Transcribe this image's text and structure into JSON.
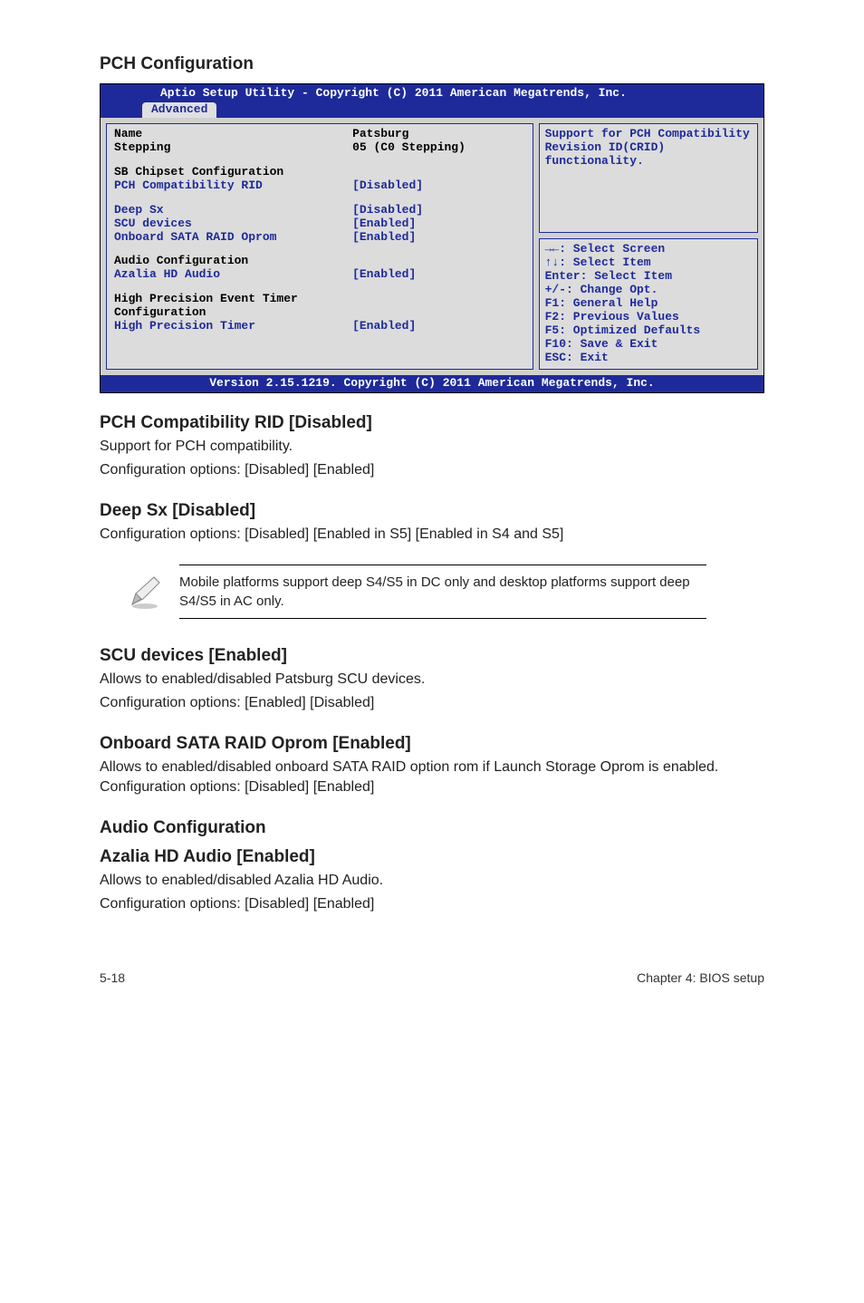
{
  "headings": {
    "pch_config": "PCH Configuration",
    "pch_compat": "PCH Compatibility RID [Disabled]",
    "deep_sx": "Deep Sx [Disabled]",
    "scu": "SCU devices [Enabled]",
    "sata_raid": "Onboard SATA RAID Oprom [Enabled]",
    "audio_cfg": "Audio Configuration",
    "azalia": "Azalia HD Audio [Enabled]"
  },
  "paragraphs": {
    "pch_compat_1": "Support for PCH compatibility.",
    "pch_compat_2": "Configuration options: [Disabled] [Enabled]",
    "deep_sx_1": "Configuration options: [Disabled] [Enabled in S5] [Enabled in S4 and S5]",
    "scu_1": "Allows to enabled/disabled Patsburg SCU devices.",
    "scu_2": "Configuration options: [Enabled] [Disabled]",
    "sata_1": "Allows to enabled/disabled onboard SATA RAID option rom if Launch Storage Oprom is enabled. Configuration options: [Disabled] [Enabled]",
    "azalia_1": "Allows to enabled/disabled Azalia HD Audio.",
    "azalia_2": "Configuration options: [Disabled] [Enabled]"
  },
  "note": {
    "text": "Mobile platforms support deep S4/S5 in DC only and desktop platforms support deep S4/S5 in AC only."
  },
  "bios": {
    "title": "Aptio Setup Utility - Copyright (C) 2011 American Megatrends, Inc.",
    "tab": "Advanced",
    "footer": "Version 2.15.1219. Copyright (C) 2011 American Megatrends, Inc.",
    "left": {
      "name_label": "Name",
      "name_value": "Patsburg",
      "stepping_label": "Stepping",
      "stepping_value": "05 (C0 Stepping)",
      "sb_heading": "SB Chipset Configuration",
      "pch_rid_label": "PCH Compatibility RID",
      "pch_rid_value": "[Disabled]",
      "deep_sx_label": "Deep Sx",
      "deep_sx_value": "[Disabled]",
      "scu_label": "SCU devices",
      "scu_value": "[Enabled]",
      "sata_label": "Onboard SATA RAID Oprom",
      "sata_value": "[Enabled]",
      "audio_heading": "Audio Configuration",
      "azalia_label": "Azalia HD Audio",
      "azalia_value": "[Enabled]",
      "hpet_heading": "High Precision Event Timer Configuration",
      "hpet_label": "High Precision Timer",
      "hpet_value": "[Enabled]"
    },
    "help": {
      "line1": "Support for PCH Compatibility",
      "line2": "Revision ID(CRID)",
      "line3": "functionality."
    },
    "nav": {
      "l1": "→←: Select Screen",
      "l2": "↑↓:  Select Item",
      "l3": "Enter: Select Item",
      "l4": "+/-: Change Opt.",
      "l5": "F1: General Help",
      "l6": "F2: Previous Values",
      "l7": "F5: Optimized Defaults",
      "l8": "F10: Save & Exit",
      "l9": "ESC: Exit"
    }
  },
  "footer": {
    "left": "5-18",
    "right": "Chapter 4: BIOS setup"
  }
}
